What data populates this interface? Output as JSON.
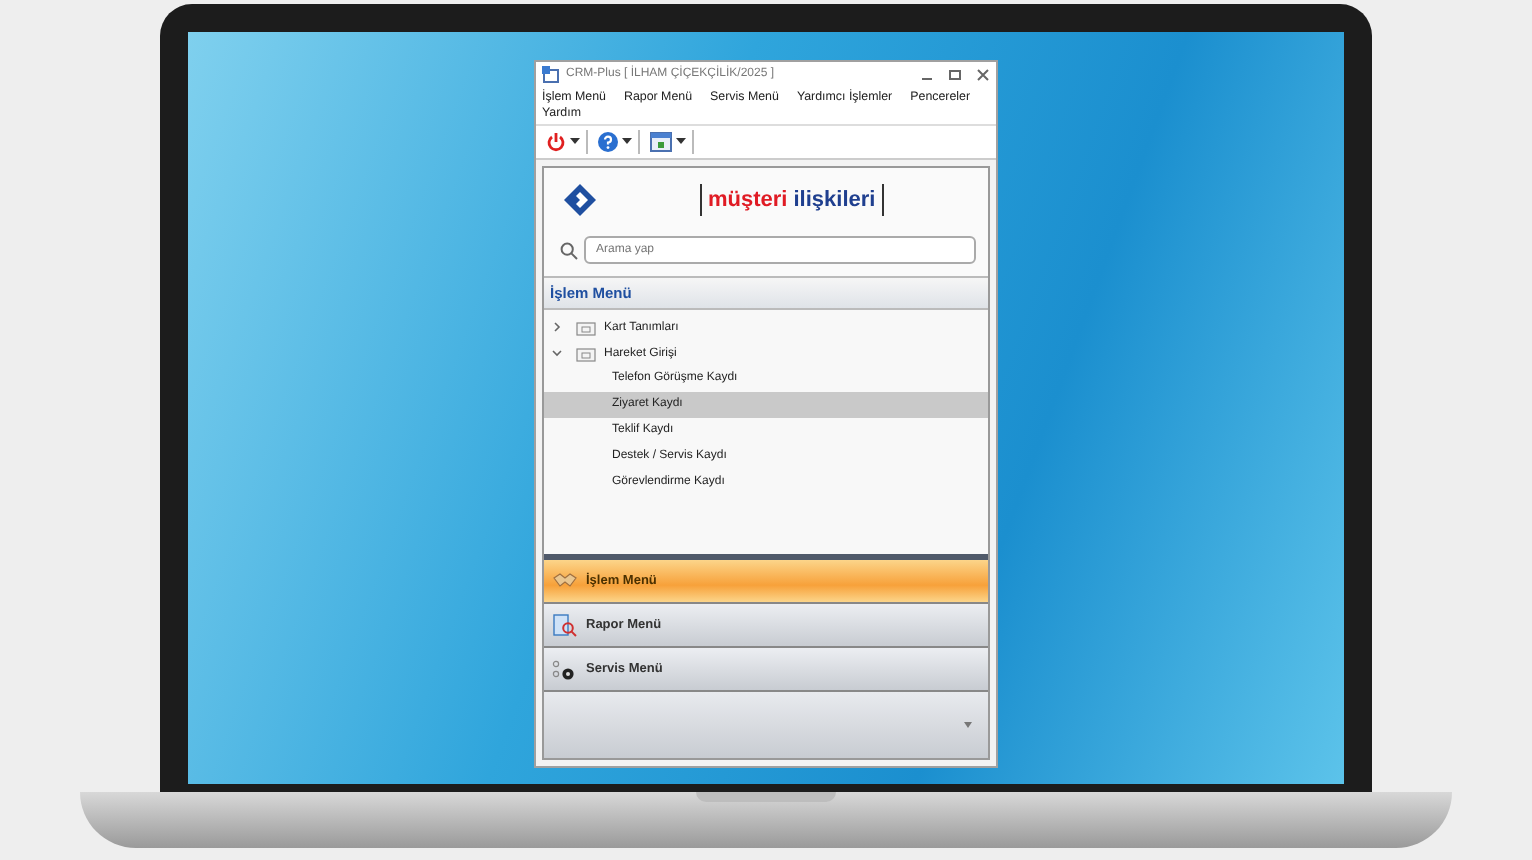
{
  "window": {
    "title": "CRM-Plus [ İLHAM ÇİÇEKÇİLİK/2025 ]"
  },
  "menu": [
    "İşlem Menü",
    "Rapor Menü",
    "Servis Menü",
    "Yardımcı İşlemler",
    "Pencereler",
    "Yardım"
  ],
  "logo": {
    "word_1": "müşteri",
    "word_2": "ilişkileri"
  },
  "search": {
    "placeholder": "Arama yap"
  },
  "panel": {
    "title": "İşlem Menü"
  },
  "tree": [
    {
      "label": "Kart Tanımları",
      "expanded": false
    },
    {
      "label": "Hareket Girişi",
      "expanded": true,
      "children": [
        {
          "label": "Telefon Görüşme Kaydı",
          "selected": false
        },
        {
          "label": "Ziyaret Kaydı",
          "selected": true
        },
        {
          "label": "Teklif Kaydı",
          "selected": false
        },
        {
          "label": "Destek / Servis Kaydı",
          "selected": false
        },
        {
          "label": "Görevlendirme Kaydı",
          "selected": false
        }
      ]
    }
  ],
  "nav_groups": [
    {
      "kind": "handshake",
      "label": "İşlem Menü",
      "selected": true
    },
    {
      "kind": "report",
      "label": "Rapor Menü",
      "selected": false
    },
    {
      "kind": "service",
      "label": "Servis Menü",
      "selected": false
    }
  ]
}
